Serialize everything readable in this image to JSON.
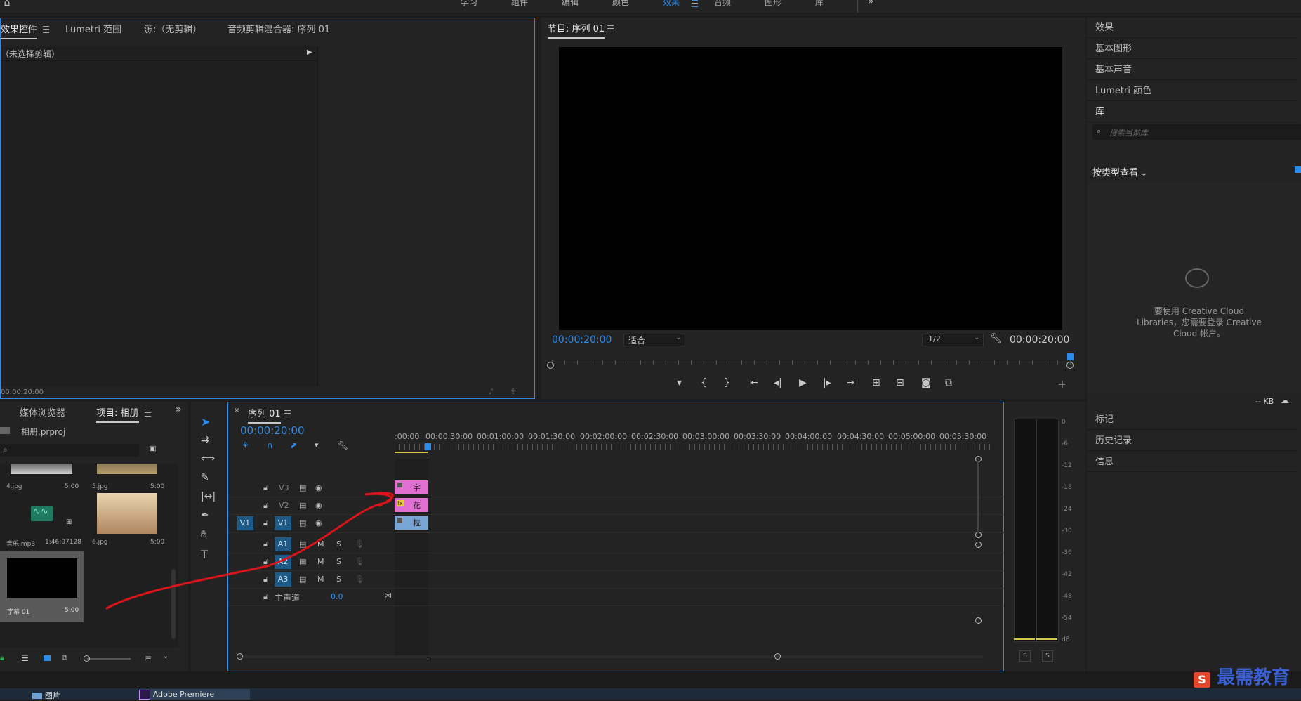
{
  "colors": {
    "accent": "#2d8ceb",
    "clip_pink": "#e06fd1",
    "clip_blue": "#7aa6d6",
    "annotation": "#d9141a"
  },
  "workspace_tabs": [
    "学习",
    "组件",
    "编辑",
    "颜色",
    "效果",
    "音频",
    "图形",
    "库"
  ],
  "workspace_active": "效果",
  "workspace_more": "»",
  "source_panel": {
    "tabs": [
      "效果控件",
      "Lumetri 范围",
      "源:（无剪辑）",
      "音频剪辑混合器: 序列 01"
    ],
    "no_clip": "（未选择剪辑）",
    "timecode": "00:00:20:00"
  },
  "program": {
    "title": "节目: 序列 01",
    "timecode_left": "00:00:20:00",
    "fit": "适合",
    "quality": "1/2",
    "timecode_right": "00:00:20:00"
  },
  "project": {
    "tabs": [
      "媒体浏览器",
      "项目: 相册"
    ],
    "file": "相册.prproj",
    "search_placeholder": "",
    "items": [
      {
        "name": "4.jpg",
        "dur": "5:00"
      },
      {
        "name": "5.jpg",
        "dur": "5:00"
      },
      {
        "name": "音乐.mp3",
        "dur": "1:46:07128"
      },
      {
        "name": "6.jpg",
        "dur": "5:00"
      },
      {
        "name": "字幕 01",
        "dur": "5:00"
      }
    ]
  },
  "timeline": {
    "tab": "序列 01",
    "timecode": "00:00:20:00",
    "ruler": [
      ":00:00",
      "00:00:30:00",
      "00:01:00:00",
      "00:01:30:00",
      "00:02:00:00",
      "00:02:30:00",
      "00:03:00:00",
      "00:03:30:00",
      "00:04:00:00",
      "00:04:30:00",
      "00:05:00:00",
      "00:05:30:00"
    ],
    "video_tracks": [
      "V3",
      "V2",
      "V1"
    ],
    "audio_tracks": [
      "A1",
      "A2",
      "A3"
    ],
    "source_patch": "V1",
    "master_label": "主声道",
    "master_value": "0.0",
    "mute": "M",
    "solo": "S",
    "clips": [
      {
        "track": "V3",
        "label": "字"
      },
      {
        "track": "V2",
        "label": "花",
        "fx": "fx"
      },
      {
        "track": "V1",
        "label": "粒"
      }
    ]
  },
  "meter": {
    "scale": [
      "0",
      "-6",
      "-12",
      "-18",
      "-24",
      "-30",
      "-36",
      "-42",
      "-48",
      "-54",
      "dB"
    ],
    "solo_left": "S",
    "solo_right": "S"
  },
  "right_panel": {
    "top_items": [
      "效果",
      "基本图形",
      "基本声音",
      "Lumetri 颜色",
      "库"
    ],
    "search_placeholder": "搜索当前库",
    "view_by": "按类型查看",
    "cc_message": "要使用 Creative Cloud Libraries，您需要登录 Creative Cloud 帐户。",
    "kb": "-- KB",
    "bottom_items": [
      "标记",
      "历史记录",
      "信息"
    ]
  },
  "taskbar": {
    "items": [
      "图片",
      "Adobe Premiere"
    ]
  },
  "watermark": "最需教育"
}
